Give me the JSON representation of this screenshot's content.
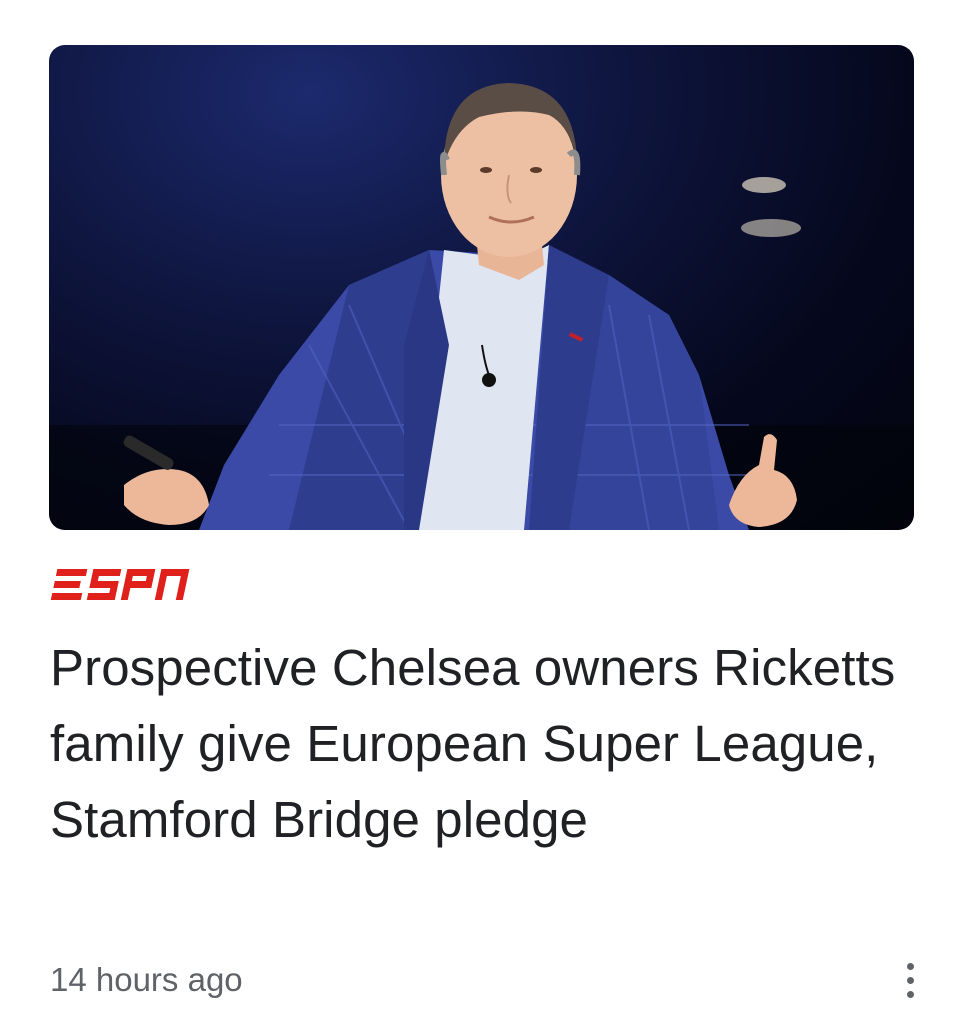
{
  "article": {
    "image_alt": "Man in blue plaid blazer speaking on stage",
    "source": {
      "name": "ESPN",
      "brand_color": "#e0201b"
    },
    "headline": "Prospective Chelsea owners Ricketts family give European Super League, Stamford Bridge pledge",
    "timestamp": "14 hours ago",
    "more_icon": "more-vert-icon"
  }
}
